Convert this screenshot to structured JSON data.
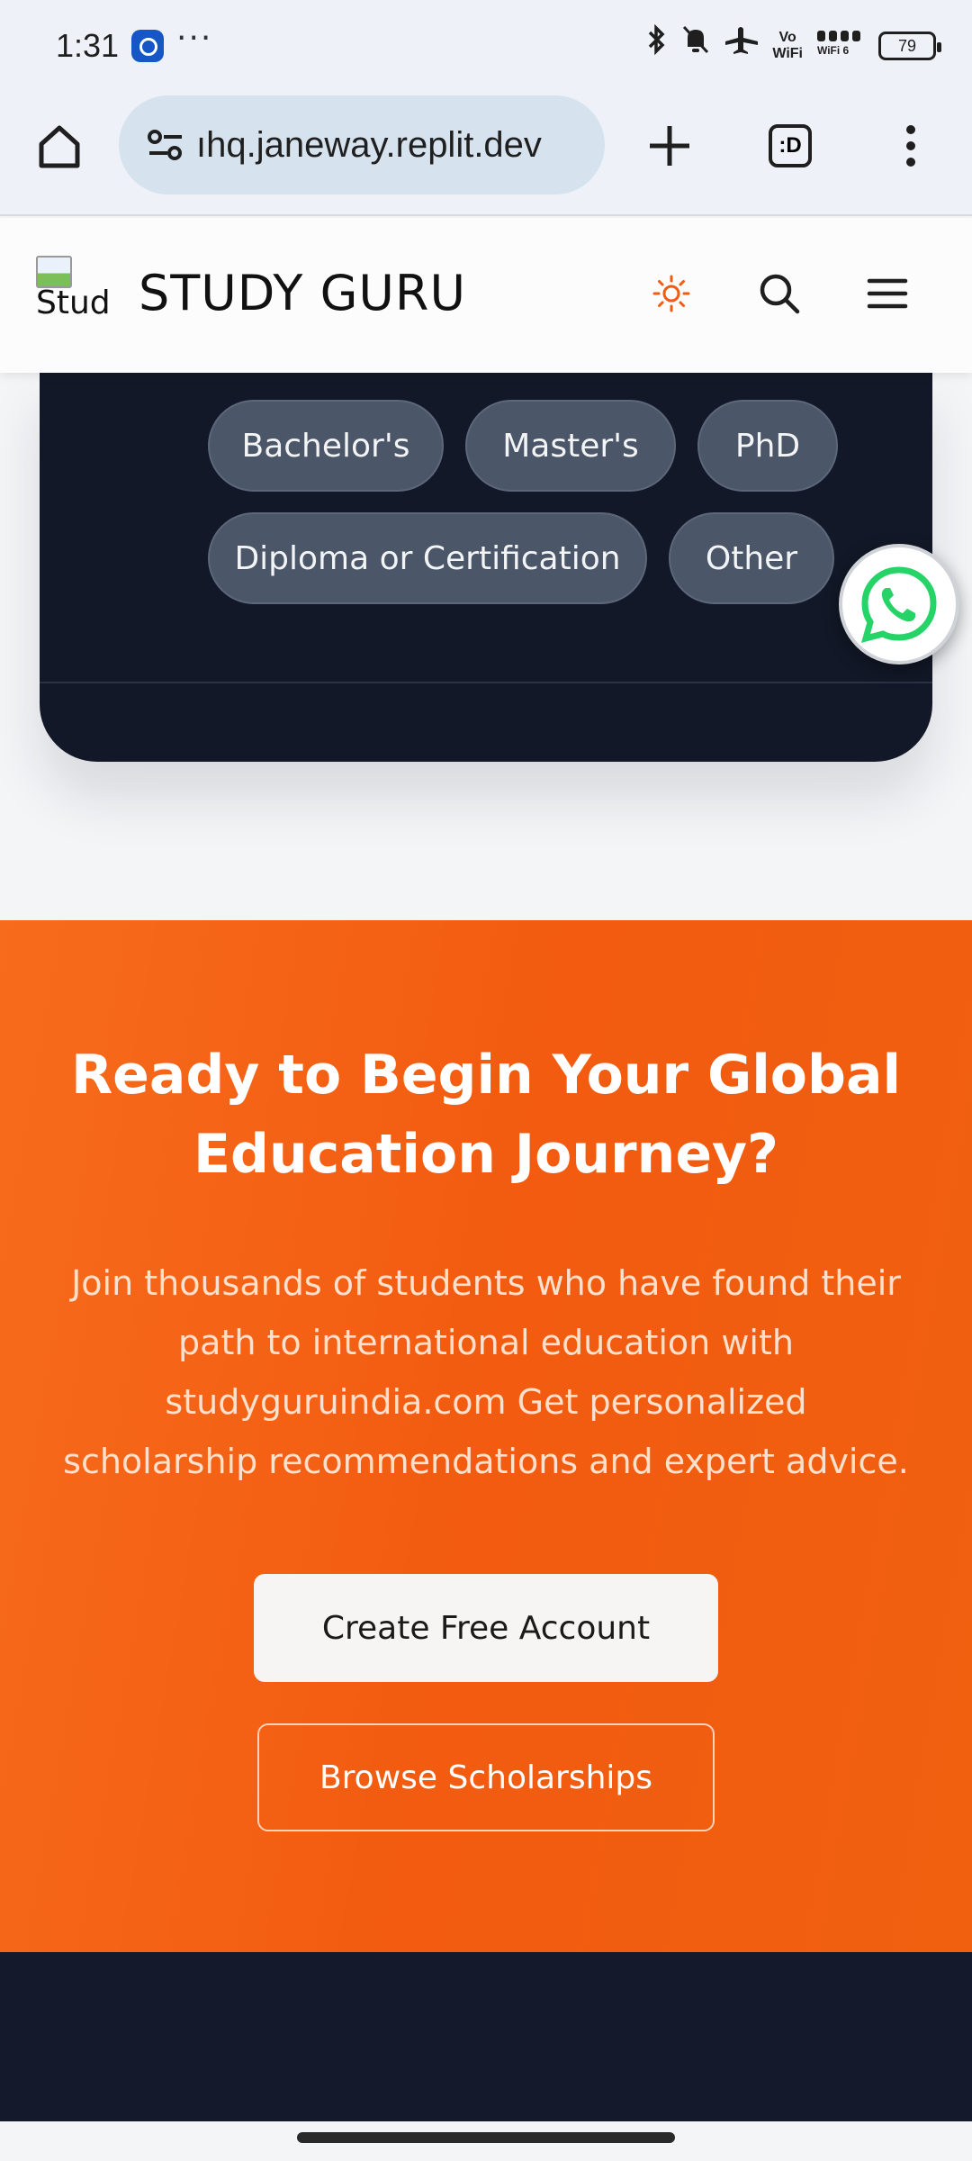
{
  "status_bar": {
    "time": "1:31",
    "more": "···",
    "vowifi_label": "Vo\nWiFi",
    "wifi_label": "WiFi 6",
    "battery": "79"
  },
  "browser": {
    "url": "ıhq.janeway.replit.dev",
    "tab_count": ":D"
  },
  "header": {
    "logo_alt": "Stud",
    "brand": "STUDY GURU"
  },
  "colors": {
    "accent_orange": "#f25b10",
    "dark_navy": "#121827",
    "whatsapp_green": "#25d366"
  },
  "degree_options": {
    "row1": [
      "Bachelor's",
      "Master's",
      "PhD"
    ],
    "row2": [
      "Diploma or Certification",
      "Other"
    ]
  },
  "cta": {
    "title": "Ready to Begin Your Global Education Journey?",
    "text": "Join thousands of students who have found their path to international education with studyguruindia.com Get personalized scholarship recommendations and expert advice.",
    "primary_button": "Create Free Account",
    "secondary_button": "Browse Scholarships"
  },
  "icons": {
    "home": "home-icon",
    "tune": "site-settings-icon",
    "new_tab": "plus-icon",
    "tabs": "tab-switcher-icon",
    "menu": "more-vert-icon",
    "theme": "sun-icon",
    "search": "search-icon",
    "nav": "hamburger-icon",
    "whatsapp": "whatsapp-icon"
  }
}
